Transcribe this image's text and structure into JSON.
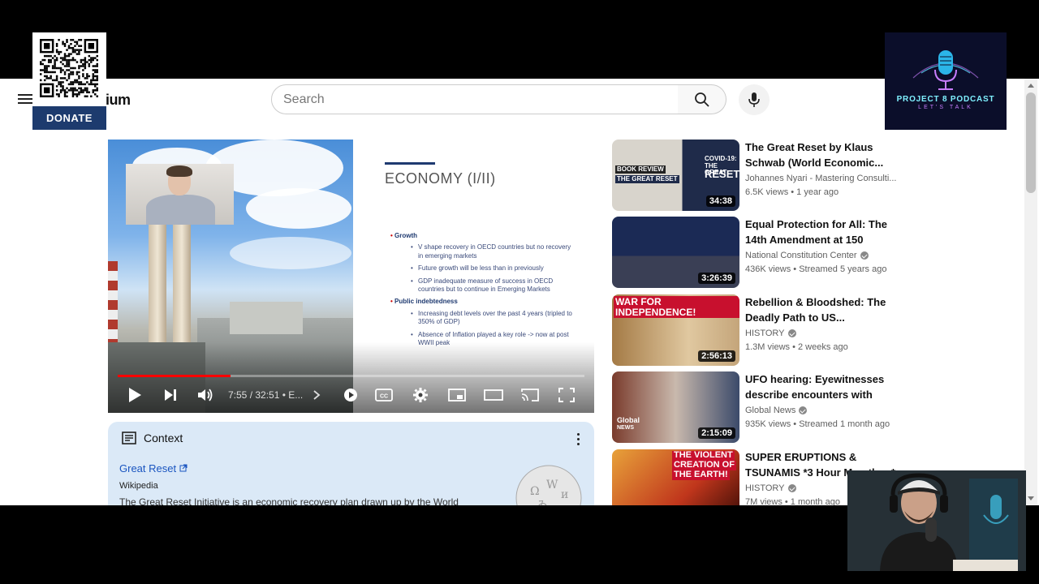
{
  "header": {
    "brand_partial": "ium",
    "search_placeholder": "Search"
  },
  "player": {
    "slide_title": "ECONOMY (I/II)",
    "slide_points": [
      {
        "level": 1,
        "text": "Growth"
      },
      {
        "level": 2,
        "text": "V shape recovery in OECD countries but no recovery in emerging markets"
      },
      {
        "level": 2,
        "text": "Future growth will be less than in previously"
      },
      {
        "level": 2,
        "text": "GDP inadequate measure of success in OECD countries but to continue in Emerging Markets"
      },
      {
        "level": 1,
        "text": "Public indebtedness"
      },
      {
        "level": 2,
        "text": "Increasing debt levels over the past 4 years (tripled to 350% of GDP)"
      },
      {
        "level": 2,
        "text": "Absence of Inflation played a key role -> now at post WWII peak"
      }
    ],
    "time_display": "7:55 / 32:51 • E...",
    "progress_fraction": 0.241
  },
  "context": {
    "heading": "Context",
    "link_text": "Great Reset",
    "source": "Wikipedia",
    "description": "The Great Reset Initiative is an economic recovery plan drawn up by the World"
  },
  "recommendations": [
    {
      "title": "The Great Reset by Klaus Schwab (World Economic...",
      "channel": "Johannes Nyari - Mastering Consulti...",
      "verified": false,
      "meta": "6.5K views • 1 year ago",
      "duration": "34:38",
      "thumb_text": [
        "BOOK REVIEW",
        "THE GREAT RESET",
        "COVID-19:",
        "THE GREAT",
        "RESET"
      ]
    },
    {
      "title": "Equal Protection for All: The 14th Amendment at 150",
      "channel": "National Constitution Center",
      "verified": true,
      "meta": "436K views • Streamed 5 years ago",
      "duration": "3:26:39",
      "thumb_text": []
    },
    {
      "title": "Rebellion & Bloodshed: The Deadly Path to US...",
      "channel": "HISTORY",
      "verified": true,
      "meta": "1.3M views • 2 weeks ago",
      "duration": "2:56:13",
      "thumb_text": [
        "WAR FOR INDEPENDENCE!"
      ]
    },
    {
      "title": "UFO hearing: Eyewitnesses describe encounters with \"non...",
      "channel": "Global News",
      "verified": true,
      "meta": "935K views • Streamed 1 month ago",
      "duration": "2:15:09",
      "thumb_text": [
        "Global",
        "NEWS"
      ]
    },
    {
      "title": "SUPER ERUPTIONS & TSUNAMIS *3 Hour Marathon*",
      "channel": "HISTORY",
      "verified": true,
      "meta": "7M views • 1 month ago",
      "duration": "",
      "thumb_text": [
        "THE VIOLENT",
        "CREATION OF",
        "THE EARTH!"
      ]
    }
  ],
  "overlays": {
    "donate_label": "DONATE",
    "podcast_name": "PROJECT 8 PODCAST",
    "podcast_tagline": "LET'S TALK"
  },
  "colors": {
    "progress": "#ff0000",
    "donate_bg": "#1d3b6e",
    "context_bg": "#dbe9f7",
    "link": "#1a55c0"
  }
}
